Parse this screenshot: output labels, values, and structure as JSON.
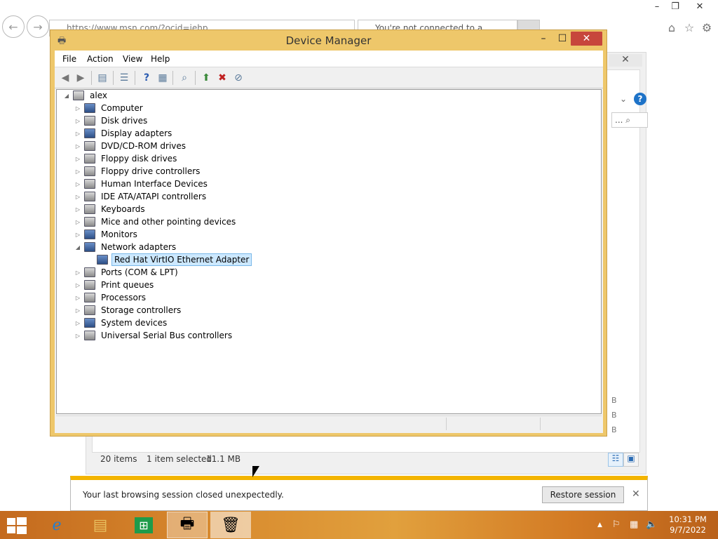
{
  "browser": {
    "address": "https://www.msn.com/?ocid=iehp",
    "tab_title": "You're not connected to a...",
    "window_controls": {
      "minimize": "–",
      "restore": "❐",
      "close": "✕"
    },
    "icons": [
      "home-icon",
      "star-icon",
      "gear-icon"
    ]
  },
  "downloads_panel": {
    "close": "✕",
    "help": "?",
    "search_glyph": "... ⌕",
    "size_labels": [
      "B",
      "B",
      "B"
    ],
    "status": {
      "items": "20 items",
      "selected": "1 item selected",
      "size": "11.1 MB"
    }
  },
  "notification": {
    "message": "Your last browsing session closed unexpectedly.",
    "restore_label": "Restore session",
    "close": "✕"
  },
  "device_manager": {
    "title": "Device Manager",
    "controls": {
      "minimize": "–",
      "maximize": "☐",
      "close": "✕"
    },
    "menu": [
      "File",
      "Action",
      "View",
      "Help"
    ],
    "toolbar": [
      "back-icon",
      "forward-icon",
      "properties-icon",
      "list-icon",
      "help-icon",
      "view-icon",
      "scan-icon",
      "update-driver-icon",
      "uninstall-icon",
      "disable-icon"
    ],
    "tree": {
      "root": "alex",
      "categories": [
        {
          "label": "Computer",
          "icon": "computer-icon"
        },
        {
          "label": "Disk drives",
          "icon": "disk-icon"
        },
        {
          "label": "Display adapters",
          "icon": "display-icon"
        },
        {
          "label": "DVD/CD-ROM drives",
          "icon": "dvd-icon"
        },
        {
          "label": "Floppy disk drives",
          "icon": "floppy-icon"
        },
        {
          "label": "Floppy drive controllers",
          "icon": "controller-icon"
        },
        {
          "label": "Human Interface Devices",
          "icon": "hid-icon"
        },
        {
          "label": "IDE ATA/ATAPI controllers",
          "icon": "ide-icon"
        },
        {
          "label": "Keyboards",
          "icon": "keyboard-icon"
        },
        {
          "label": "Mice and other pointing devices",
          "icon": "mouse-icon"
        },
        {
          "label": "Monitors",
          "icon": "monitor-icon"
        },
        {
          "label": "Network adapters",
          "icon": "network-icon",
          "expanded": true
        },
        {
          "label": "Red Hat VirtIO Ethernet Adapter",
          "icon": "network-adapter-icon",
          "child": true,
          "selected": true
        },
        {
          "label": "Ports (COM & LPT)",
          "icon": "port-icon"
        },
        {
          "label": "Print queues",
          "icon": "printer-icon"
        },
        {
          "label": "Processors",
          "icon": "processor-icon"
        },
        {
          "label": "Storage controllers",
          "icon": "storage-icon"
        },
        {
          "label": "System devices",
          "icon": "system-icon"
        },
        {
          "label": "Universal Serial Bus controllers",
          "icon": "usb-icon"
        }
      ]
    }
  },
  "taskbar": {
    "apps": [
      "internet-explorer-icon",
      "file-explorer-icon",
      "store-icon",
      "device-manager-icon",
      "recycle-icon"
    ],
    "time": "10:31 PM",
    "date": "9/7/2022"
  }
}
